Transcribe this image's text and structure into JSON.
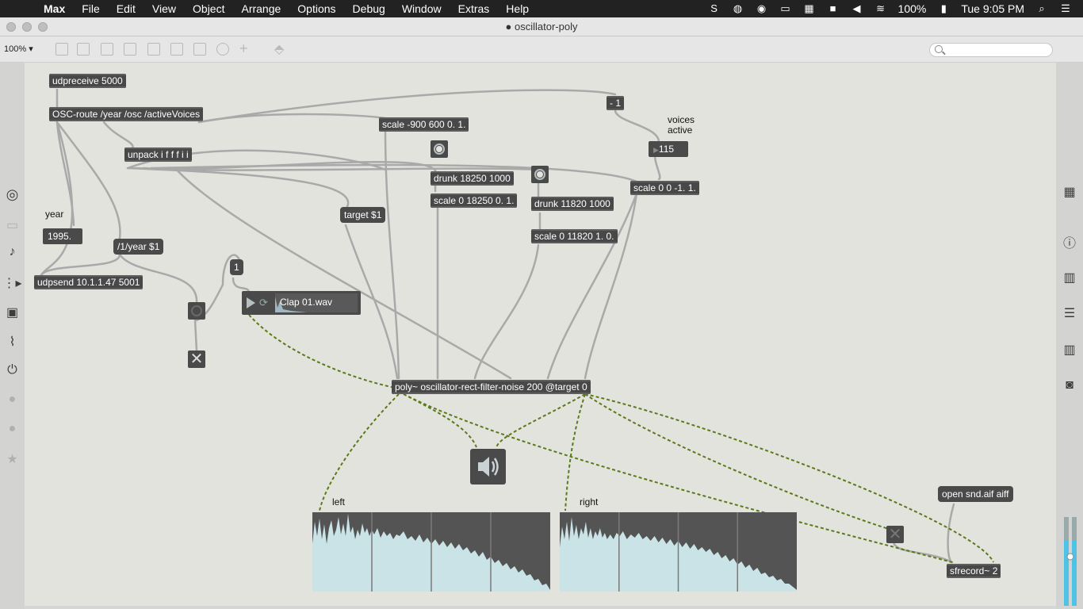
{
  "menubar": {
    "app_name": "Max",
    "menus": [
      "File",
      "Edit",
      "View",
      "Object",
      "Arrange",
      "Options",
      "Debug",
      "Window",
      "Extras",
      "Help"
    ],
    "battery": "100%",
    "clock": "Tue 9:05 PM"
  },
  "window": {
    "title": "oscillator-poly"
  },
  "toolbar": {
    "zoom": "100% ▾"
  },
  "objects": {
    "udpreceive": "udpreceive 5000",
    "osc_route": "OSC-route /year /osc /activeVoices",
    "unpack": "unpack i f f f i i",
    "scale_main": "scale -900 600 0. 1.",
    "minus": "- 1",
    "drunk1": "drunk 18250 1000",
    "scale1": "scale 0 18250 0. 1.",
    "drunk2": "drunk 11820 1000",
    "scale2": "scale 0 11820 1. 0.",
    "scale_voices": "scale 0 0 -1. 1.",
    "udpsend": "udpsend 10.1.1.47 5001",
    "poly": "poly~ oscillator-rect-filter-noise 200 @target 0",
    "sfrecord": "sfrecord~ 2"
  },
  "messages": {
    "target": "target $1",
    "year_msg": "/1/year $1",
    "one": "1",
    "open": "open snd.aif aiff"
  },
  "numbers": {
    "year_value": "1995.",
    "voices_value": "115"
  },
  "comments": {
    "year": "year",
    "voices": "voices\nactive",
    "left": "left",
    "right": "right"
  },
  "playlist": {
    "file": "Clap 01.wav"
  },
  "colors": {
    "canvas": "#e3e3de",
    "object": "#484848",
    "signal_cord": "#6b8e23",
    "scope_fill": "#c9e3e6"
  }
}
